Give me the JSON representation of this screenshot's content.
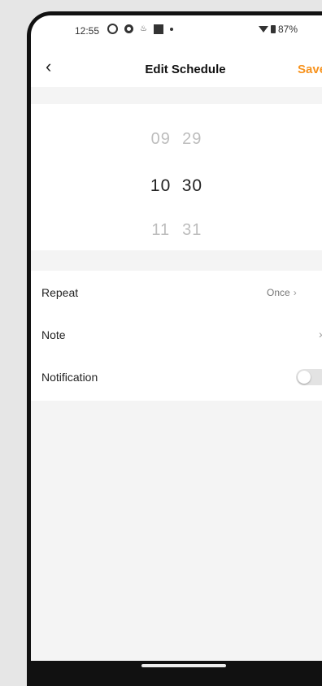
{
  "status_bar": {
    "time": "12:55",
    "battery": "87%"
  },
  "header": {
    "back_icon": "chevron-left-icon",
    "title": "Edit Schedule",
    "save_label": "Save",
    "save_color": "#f7931e"
  },
  "picker": {
    "rows": [
      {
        "hour": "09",
        "minute": "29"
      },
      {
        "hour": "10",
        "minute": "30"
      },
      {
        "hour": "11",
        "minute": "31"
      }
    ],
    "selected_index": 1
  },
  "settings": {
    "repeat_label": "Repeat",
    "repeat_value": "Once",
    "note_label": "Note",
    "notification_label": "Notification",
    "notification_on": false
  }
}
